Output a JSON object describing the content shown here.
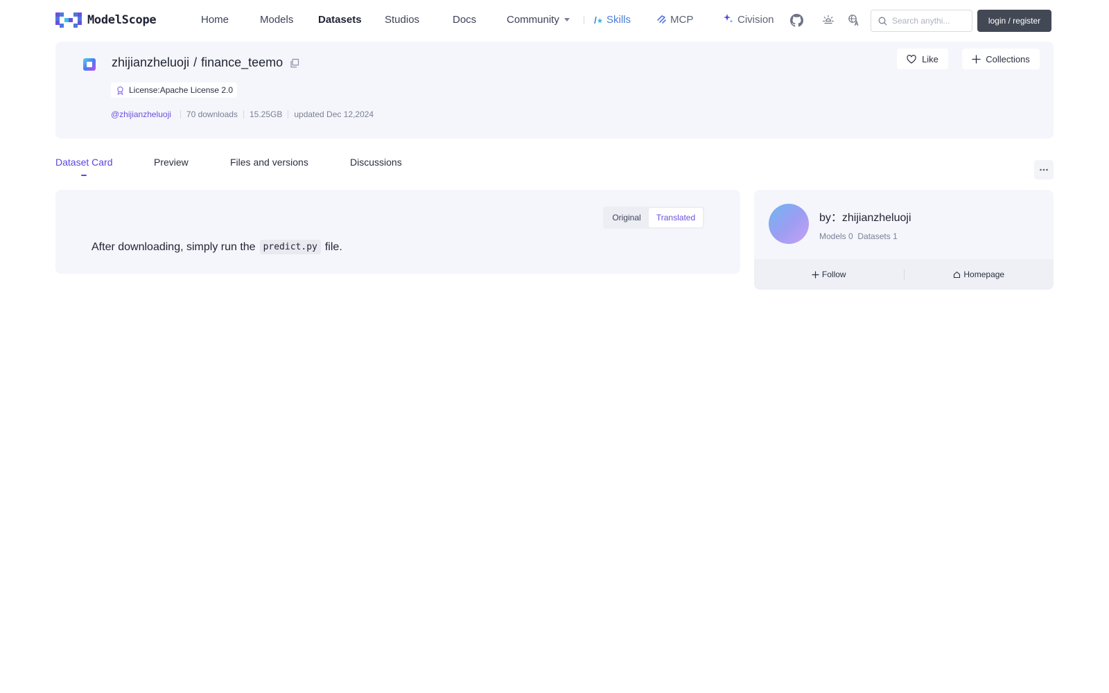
{
  "brand": {
    "name": "ModelScope"
  },
  "nav": {
    "home": "Home",
    "models": "Models",
    "datasets": "Datasets",
    "studios": "Studios",
    "docs": "Docs",
    "community": "Community",
    "skills": "Skills",
    "mcp": "MCP",
    "civision": "Civision"
  },
  "search": {
    "placeholder": "Search anythi..."
  },
  "auth": {
    "login_label": "login / register"
  },
  "dataset": {
    "owner": "zhijianzheluoji",
    "separator": "/",
    "name": "finance_teemo",
    "license": "License:Apache License 2.0",
    "author_handle": "@zhijianzheluoji",
    "downloads": "70 downloads",
    "size": "15.25GB",
    "updated": "updated Dec 12,2024"
  },
  "actions": {
    "like": "Like",
    "collections": "Collections"
  },
  "tabs": [
    {
      "label": "Dataset Card",
      "active": true
    },
    {
      "label": "Preview",
      "active": false
    },
    {
      "label": "Files and versions",
      "active": false
    },
    {
      "label": "Discussions",
      "active": false
    }
  ],
  "card": {
    "toggle_original": "Original",
    "toggle_translated": "Translated",
    "readme_before": "After downloading, simply run the",
    "readme_code": "predict.py",
    "readme_after": "file."
  },
  "author": {
    "by_label": "by：zhijianzheluoji",
    "models_count": "Models 0",
    "datasets_count": "Datasets 1",
    "follow": "Follow",
    "homepage": "Homepage"
  },
  "colors": {
    "accent": "#5a45e0",
    "login_bg": "#434855",
    "card_bg": "#f5f6fb"
  }
}
